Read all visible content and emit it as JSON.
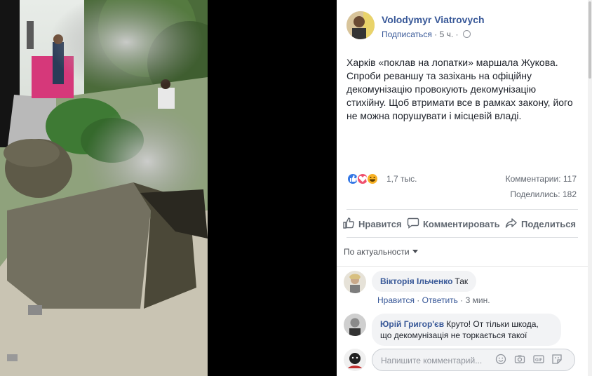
{
  "post": {
    "author": "Volodymyr Viatrovych",
    "subscribe": "Подписаться",
    "time": "5 ч.",
    "text": "Харків «поклав на лопатки» маршала Жукова.\nСпроби реваншу та зазіхань на офіційну\nдекомунізацію провокують декомунізацію\nстихійну. Щоб втримати все в рамках закону, його\nне можна порушувати і місцевій владі."
  },
  "stats": {
    "reactions": "1,7 тыс.",
    "comments": "Комментарии: 117",
    "shares": "Поделились: 182"
  },
  "actions": {
    "like": "Нравится",
    "comment": "Комментировать",
    "share": "Поделиться"
  },
  "sort": {
    "label": "По актуальности"
  },
  "comments": [
    {
      "name": "Вікторія Ільченко",
      "text": "Так",
      "like": "Нравится",
      "reply": "Ответить",
      "time": "3 мин."
    },
    {
      "name": "Юрій Григор'єв",
      "text": "Круто! От тільки шкода,",
      "text2": "що декомунізація не торкається такої"
    }
  ],
  "composer": {
    "placeholder": "Напишите комментарий..."
  },
  "colors": {
    "link": "#385898",
    "text": "#1d2129",
    "muted": "#616770"
  }
}
